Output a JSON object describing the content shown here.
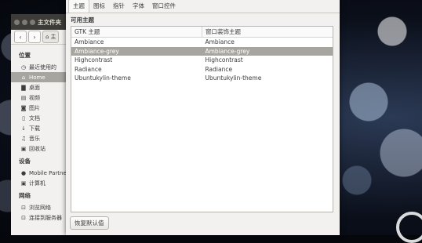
{
  "file_manager": {
    "title": "主文件夹",
    "path_label": "主",
    "sections": [
      {
        "label": "位置",
        "items": [
          {
            "icon": "clock-icon",
            "glyph": "◷",
            "label": "最近使用的",
            "active": false
          },
          {
            "icon": "home-icon",
            "glyph": "⌂",
            "label": "Home",
            "active": true
          },
          {
            "icon": "folder-icon",
            "glyph": "▇",
            "label": "桌面",
            "active": false
          },
          {
            "icon": "film-icon",
            "glyph": "▤",
            "label": "视频",
            "active": false
          },
          {
            "icon": "camera-icon",
            "glyph": "◙",
            "label": "图片",
            "active": false
          },
          {
            "icon": "document-icon",
            "glyph": "▯",
            "label": "文档",
            "active": false
          },
          {
            "icon": "download-icon",
            "glyph": "↓",
            "label": "下载",
            "active": false
          },
          {
            "icon": "music-icon",
            "glyph": "♫",
            "label": "音乐",
            "active": false
          },
          {
            "icon": "trash-icon",
            "glyph": "▣",
            "label": "回收站",
            "active": false
          }
        ]
      },
      {
        "label": "设备",
        "items": [
          {
            "icon": "disc-icon",
            "glyph": "●",
            "label": "Mobile Partner",
            "active": false
          },
          {
            "icon": "computer-icon",
            "glyph": "▣",
            "label": "计算机",
            "active": false
          }
        ]
      },
      {
        "label": "网络",
        "items": [
          {
            "icon": "network-icon",
            "glyph": "⊡",
            "label": "浏览网络",
            "active": false
          },
          {
            "icon": "network-icon",
            "glyph": "⊡",
            "label": "连接到服务器",
            "active": false
          }
        ]
      }
    ]
  },
  "settings": {
    "tabs": [
      {
        "label": "主题",
        "active": true
      },
      {
        "label": "图标",
        "active": false
      },
      {
        "label": "指针",
        "active": false
      },
      {
        "label": "字体",
        "active": false
      },
      {
        "label": "窗口控件",
        "active": false
      }
    ],
    "section_title": "可用主题",
    "columns": [
      "GTK 主题",
      "窗口装饰主题"
    ],
    "rows": [
      {
        "gtk": "Ambiance",
        "wm": "Ambiance",
        "selected": false
      },
      {
        "gtk": "Ambiance-grey",
        "wm": "Ambiance-grey",
        "selected": true
      },
      {
        "gtk": "Highcontrast",
        "wm": "Highcontrast",
        "selected": false
      },
      {
        "gtk": "Radiance",
        "wm": "Radiance",
        "selected": false
      },
      {
        "gtk": "Ubuntukylin-theme",
        "wm": "Ubuntukylin-theme",
        "selected": false
      }
    ],
    "reset_label": "恢复默认值"
  }
}
